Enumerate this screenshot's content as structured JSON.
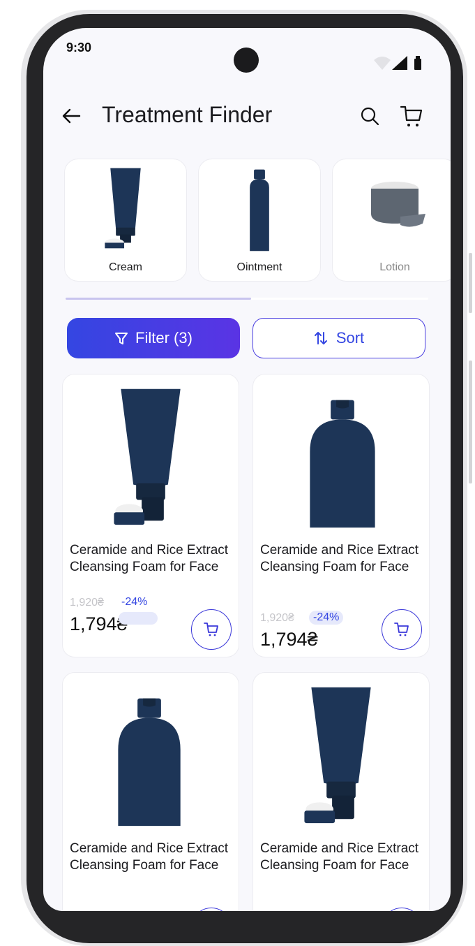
{
  "status_bar": {
    "time": "9:30"
  },
  "header": {
    "title": "Treatment Finder",
    "back_icon": "arrow-left-icon",
    "search_icon": "search-icon",
    "cart_icon": "cart-icon"
  },
  "categories": [
    {
      "label": "Cream"
    },
    {
      "label": "Ointment"
    },
    {
      "label": "Lotion"
    }
  ],
  "toolbar": {
    "filter_label": "Filter (3)",
    "sort_label": "Sort",
    "filter_icon": "filter-icon",
    "sort_icon": "sort-icon"
  },
  "products": [
    {
      "name": "Ceramide and Rice Extract Cleansing Foam for Face",
      "old_price": "1,920₴",
      "discount": "-24%",
      "price": "1,794₴",
      "image": "tube"
    },
    {
      "name": "Ceramide and Rice Extract Cleansing Foam for Face",
      "old_price": "1,920₴",
      "discount": "-24%",
      "price": "1,794₴",
      "image": "bottle"
    },
    {
      "name": "Ceramide and Rice Extract Cleansing Foam for Face",
      "image": "bottle"
    },
    {
      "name": "Ceramide and Rice Extract Cleansing Foam for Face",
      "image": "tube"
    }
  ],
  "colors": {
    "accent": "#3446e2",
    "accent_2": "#5a34e4",
    "product_navy": "#1d3557",
    "background": "#f8f8fc"
  }
}
